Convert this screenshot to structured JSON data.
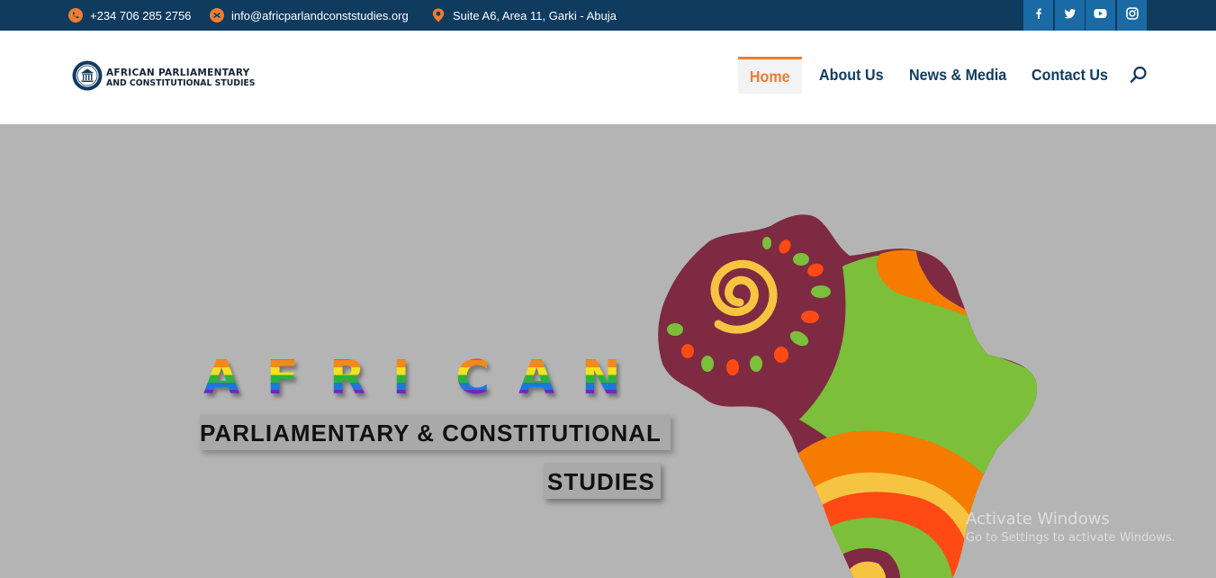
{
  "topbar": {
    "phone": "+234 706 285 2756",
    "email": "info@africparlandconststudies.org",
    "address": "Suite A6, Area 11, Garki - Abuja",
    "icon_color": "#ee7d33",
    "social": [
      "facebook-icon",
      "twitter-icon",
      "youtube-icon",
      "instagram-icon"
    ]
  },
  "logo": {
    "line1": "AFRICAN PARLIAMENTARY",
    "line2": "AND CONSTITUTIONAL STUDIES"
  },
  "nav": {
    "home": "Home",
    "about": "About Us",
    "news": "News & Media",
    "contact": "Contact Us",
    "active_color": "#ee7d33",
    "color": "#0f3b5f"
  },
  "hero": {
    "letters": [
      "A",
      "F",
      "R",
      "I",
      "C",
      "A",
      "N"
    ],
    "line2": "PARLIAMENTARY & CONSTITUTIONAL",
    "line3": "STUDIES"
  },
  "watermark": {
    "title": "Activate Windows",
    "subtitle": "Go to Settings to activate Windows."
  }
}
